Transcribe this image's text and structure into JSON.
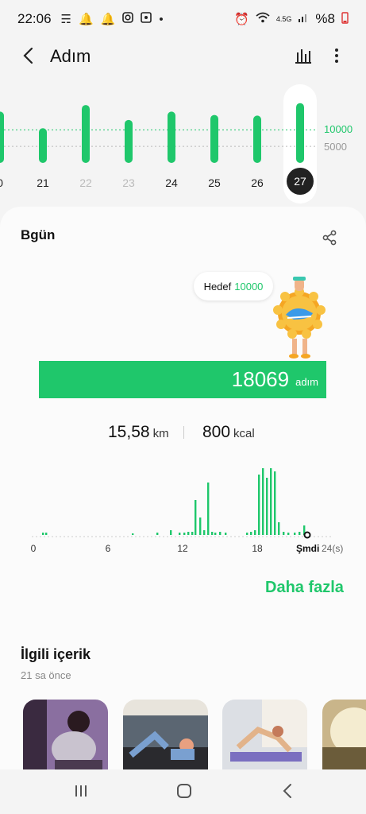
{
  "status_bar": {
    "time": "22:06",
    "battery": "%8",
    "network": "4.5G",
    "left_icons": [
      "snapchat-icon",
      "bell-icon",
      "bell-icon",
      "instagram-icon",
      "app-icon",
      "dot-icon"
    ],
    "right_icons": [
      "alarm-icon",
      "wifi-icon",
      "signal-icon",
      "battery-icon"
    ]
  },
  "app_bar": {
    "title": "Adım",
    "back_icon": "back-arrow-icon",
    "chart_icon": "bar-chart-icon",
    "more_icon": "more-vertical-icon"
  },
  "week_chart": {
    "goal_label": "10000",
    "half_label": "5000",
    "days": [
      {
        "label": "0",
        "value": 15500,
        "faded": false
      },
      {
        "label": "21",
        "value": 10500,
        "faded": false
      },
      {
        "label": "22",
        "value": 17500,
        "faded": true
      },
      {
        "label": "23",
        "value": 13000,
        "faded": true
      },
      {
        "label": "24",
        "value": 15500,
        "faded": false
      },
      {
        "label": "25",
        "value": 14500,
        "faded": false
      },
      {
        "label": "26",
        "value": 14300,
        "faded": false
      },
      {
        "label": "27",
        "value": 18069,
        "faded": false,
        "selected": true
      }
    ],
    "accent": "#1fc76b"
  },
  "today": {
    "title": "Bgün",
    "goal_prefix": "Hedef",
    "goal_value": "10000",
    "steps": "18069",
    "steps_unit": "adım",
    "progress": 1.0,
    "distance": "15,58",
    "distance_unit": "km",
    "energy": "800",
    "energy_unit": "kcal"
  },
  "hourly": {
    "hour_labels": [
      "0",
      "6",
      "12",
      "18"
    ],
    "now_label": "Şmdi",
    "hours_label": "24(s)"
  },
  "more_link": "Daha fazla",
  "related": {
    "title": "İlgili içerik",
    "time": "21 sa önce"
  },
  "nav": {
    "recent_icon": "recent-apps-icon",
    "home_icon": "home-icon",
    "back_icon": "nav-back-icon"
  }
}
